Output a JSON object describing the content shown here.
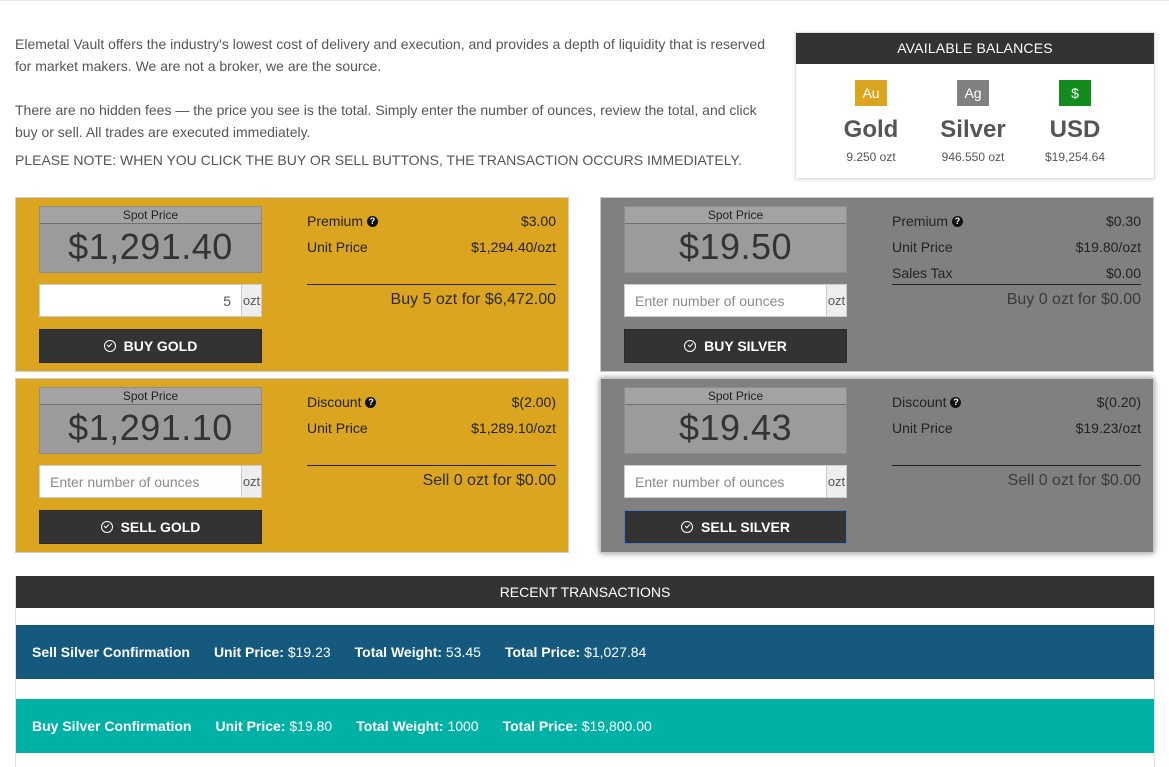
{
  "intro": {
    "p1": "Elemetal Vault offers the industry's lowest cost of delivery and execution, and provides a depth of liquidity that is reserved for market makers. We are not a broker, we are the source.",
    "p2": "There are no hidden fees — the price you see is the total. Simply enter the number of ounces, review the total, and click buy or sell. All trades are executed immediately.",
    "note": "PLEASE NOTE: WHEN YOU CLICK THE BUY OR SELL BUTTONS, THE TRANSACTION OCCURS IMMEDIATELY."
  },
  "balances": {
    "title": "AVAILABLE BALANCES",
    "items": [
      {
        "symbol": "Au",
        "name": "Gold",
        "amount": "9.250 ozt",
        "color": "#dba520"
      },
      {
        "symbol": "Ag",
        "name": "Silver",
        "amount": "946.550 ozt",
        "color": "#808080"
      },
      {
        "symbol": "$",
        "name": "USD",
        "amount": "$19,254.64",
        "color": "#128c1c"
      }
    ]
  },
  "panels": {
    "buy_gold": {
      "spot_label": "Spot Price",
      "spot_value": "$1,291.40",
      "qty_value": "5",
      "qty_placeholder": "Enter number of ounces",
      "unit": "ozt",
      "button": "BUY GOLD",
      "row1_label": "Premium",
      "row1_value": "$3.00",
      "row2_label": "Unit Price",
      "row2_value": "$1,294.40/ozt",
      "summary": "Buy 5 ozt for $6,472.00"
    },
    "buy_silver": {
      "spot_label": "Spot Price",
      "spot_value": "$19.50",
      "qty_value": "",
      "qty_placeholder": "Enter number of ounces",
      "unit": "ozt",
      "button": "BUY SILVER",
      "row1_label": "Premium",
      "row1_value": "$0.30",
      "row2_label": "Unit Price",
      "row2_value": "$19.80/ozt",
      "row3_label": "Sales Tax",
      "row3_value": "$0.00",
      "summary": "Buy 0 ozt for $0.00"
    },
    "sell_gold": {
      "spot_label": "Spot Price",
      "spot_value": "$1,291.10",
      "qty_value": "",
      "qty_placeholder": "Enter number of ounces",
      "unit": "ozt",
      "button": "SELL GOLD",
      "row1_label": "Discount",
      "row1_value": "$(2.00)",
      "row2_label": "Unit Price",
      "row2_value": "$1,289.10/ozt",
      "summary": "Sell 0 ozt for $0.00"
    },
    "sell_silver": {
      "spot_label": "Spot Price",
      "spot_value": "$19.43",
      "qty_value": "",
      "qty_placeholder": "Enter number of ounces",
      "unit": "ozt",
      "button": "SELL SILVER",
      "row1_label": "Discount",
      "row1_value": "$(0.20)",
      "row2_label": "Unit Price",
      "row2_value": "$19.23/ozt",
      "summary": "Sell 0 ozt for $0.00"
    }
  },
  "recent": {
    "title": "RECENT TRANSACTIONS",
    "unit_price_label": "Unit Price:",
    "total_weight_label": "Total Weight:",
    "total_price_label": "Total Price:",
    "rows": [
      {
        "title": "Sell Silver Confirmation",
        "unit_price": "$19.23",
        "total_weight": "53.45",
        "total_price": "$1,027.84"
      },
      {
        "title": "Buy Silver Confirmation",
        "unit_price": "$19.80",
        "total_weight": "1000",
        "total_price": "$19,800.00"
      }
    ]
  }
}
